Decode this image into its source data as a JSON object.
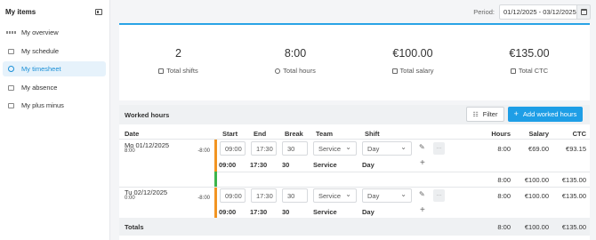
{
  "sidebar": {
    "title": "My items",
    "items": [
      {
        "label": "My overview",
        "icon": "grid-icon",
        "active": false
      },
      {
        "label": "My schedule",
        "icon": "calendar-icon",
        "active": false
      },
      {
        "label": "My timesheet",
        "icon": "clock-icon",
        "active": true
      },
      {
        "label": "My absence",
        "icon": "calendar-icon",
        "active": false
      },
      {
        "label": "My plus minus",
        "icon": "list-icon",
        "active": false
      }
    ]
  },
  "period": {
    "label": "Period:",
    "value": "01/12/2025 - 03/12/2025"
  },
  "summary": [
    {
      "value": "2",
      "label": "Total shifts",
      "icon": "calendar-icon"
    },
    {
      "value": "8:00",
      "label": "Total hours",
      "icon": "clock-icon"
    },
    {
      "value": "€100.00",
      "label": "Total salary",
      "icon": "wallet-icon"
    },
    {
      "value": "€135.00",
      "label": "Total CTC",
      "icon": "building-icon"
    }
  ],
  "worked_hours": {
    "title": "Worked hours",
    "filter_label": "Filter",
    "add_label": "Add worked hours",
    "columns": {
      "date": "Date",
      "start": "Start",
      "end": "End",
      "break": "Break",
      "team": "Team",
      "shift": "Shift",
      "hours": "Hours",
      "salary": "Salary",
      "ctc": "CTC"
    },
    "days": [
      {
        "date": "Mo 01/12/2025",
        "planned": "8:00",
        "diff": "-8:00",
        "edit": {
          "start": "09:00",
          "end": "17:30",
          "break": "30",
          "team": "Service",
          "shift": "Day"
        },
        "hours": "8:00",
        "salary": "€69.00",
        "ctc": "€93.15",
        "detail": {
          "start": "09:00",
          "end": "17:30",
          "break": "30",
          "team": "Service",
          "shift": "Day"
        },
        "subtotal": {
          "hours": "8:00",
          "salary": "€100.00",
          "ctc": "€135.00"
        }
      },
      {
        "date": "Tu 02/12/2025",
        "planned": "0:00",
        "diff": "-8:00",
        "edit": {
          "start": "09:00",
          "end": "17:30",
          "break": "30",
          "team": "Service",
          "shift": "Day"
        },
        "hours": "8:00",
        "salary": "€100.00",
        "ctc": "€135.00",
        "detail": {
          "start": "09:00",
          "end": "17:30",
          "break": "30",
          "team": "Service",
          "shift": "Day"
        }
      }
    ],
    "totals": {
      "label": "Totals",
      "hours": "8:00",
      "salary": "€100.00",
      "ctc": "€135.00"
    }
  },
  "colors": {
    "accent": "#1e9ee6",
    "orange": "#f29422",
    "green": "#3cb44b"
  }
}
